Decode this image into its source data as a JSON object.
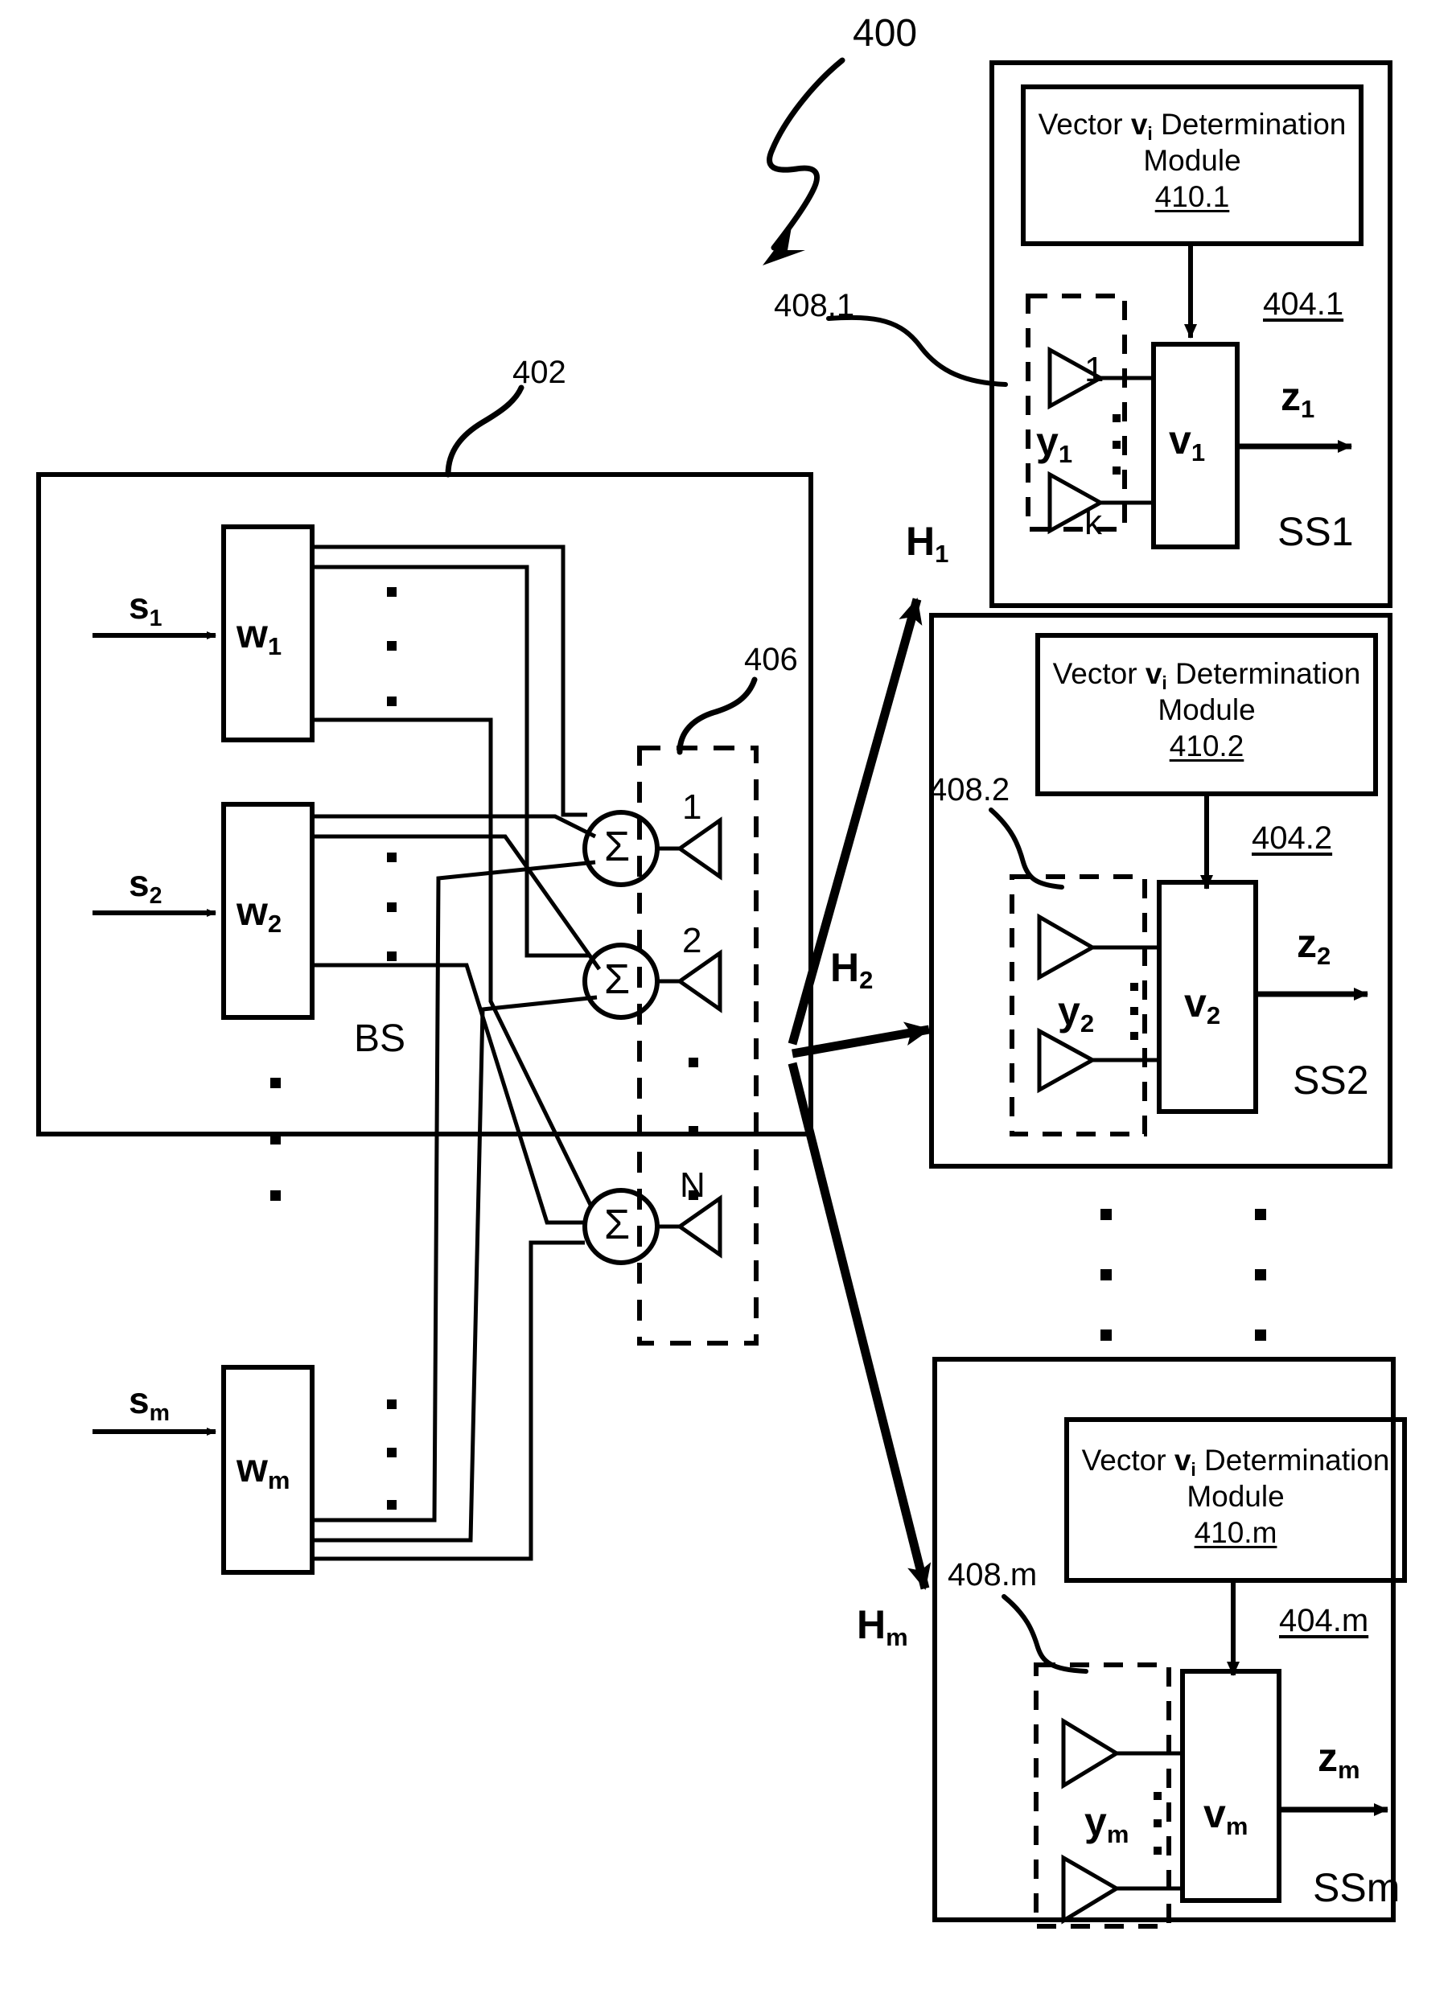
{
  "figure": {
    "number": "400",
    "base_station": {
      "ref": "402",
      "label": "BS",
      "inputs": [
        {
          "signal": "s",
          "sub": "1",
          "block": "w",
          "block_sub": "1"
        },
        {
          "signal": "s",
          "sub": "2",
          "block": "w",
          "block_sub": "2"
        },
        {
          "signal": "s",
          "sub": "m",
          "block": "w",
          "block_sub": "m"
        }
      ],
      "summation_symbol": "Σ",
      "antenna_array": {
        "ref": "406",
        "element_labels": [
          "1",
          "2",
          "N"
        ],
        "ellipsis": "vertical-dots"
      },
      "vertical_ellipsis": "vertical-dots"
    },
    "channels": [
      {
        "label": "H",
        "sub": "1"
      },
      {
        "label": "H",
        "sub": "2"
      },
      {
        "label": "H",
        "sub": "m"
      }
    ],
    "subscriber_stations": [
      {
        "name": "SS1",
        "station_ref": "404.1",
        "module_ref": "410.1",
        "antenna_ref": "408.1",
        "module_title_prefix": "Vector ",
        "module_title_vector": "v",
        "module_title_vector_sub": "i",
        "module_title_suffix": " Determination",
        "module_title_line2": "Module",
        "antenna_labels": [
          "1",
          "k"
        ],
        "receive_signal": "y",
        "receive_signal_sub": "1",
        "combiner": "v",
        "combiner_sub": "1",
        "output": "z",
        "output_sub": "1"
      },
      {
        "name": "SS2",
        "station_ref": "404.2",
        "module_ref": "410.2",
        "antenna_ref": "408.2",
        "module_title_prefix": "Vector ",
        "module_title_vector": "v",
        "module_title_vector_sub": "i",
        "module_title_suffix": " Determination",
        "module_title_line2": "Module",
        "antenna_labels": [
          "",
          ""
        ],
        "receive_signal": "y",
        "receive_signal_sub": "2",
        "combiner": "v",
        "combiner_sub": "2",
        "output": "z",
        "output_sub": "2"
      },
      {
        "name": "SSm",
        "station_ref": "404.m",
        "module_ref": "410.m",
        "antenna_ref": "408.m",
        "module_title_prefix": "Vector ",
        "module_title_vector": "v",
        "module_title_vector_sub": "i",
        "module_title_suffix": " Determination",
        "module_title_line2": "Module",
        "antenna_labels": [
          "",
          ""
        ],
        "receive_signal": "y",
        "receive_signal_sub": "m",
        "combiner": "v",
        "combiner_sub": "m",
        "output": "z",
        "output_sub": "m"
      }
    ],
    "colors": {
      "ink": "#000000",
      "paper": "#ffffff"
    }
  }
}
